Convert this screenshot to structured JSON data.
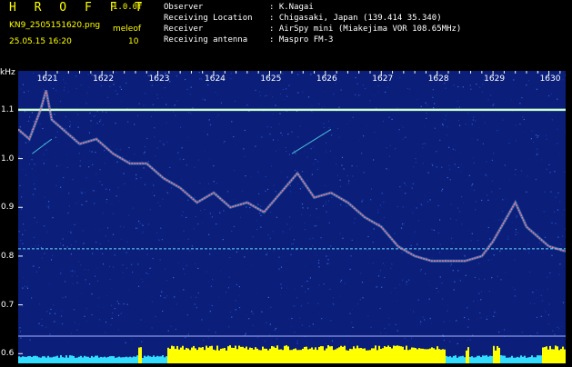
{
  "header": {
    "title": "H R O F F T",
    "version": "1.0.0f",
    "filename": "KN9_2505151620.png",
    "mode_label": "meleof",
    "datetime": "25.05.15 16:20",
    "mode_value": "10",
    "info": [
      {
        "label": "Observer",
        "value": ": K.Nagai"
      },
      {
        "label": "Receiving Location",
        "value": ": Chigasaki, Japan (139.414 35.340)"
      },
      {
        "label": "Receiver",
        "value": ": AirSpy mini (Miakejima VOR 108.65MHz)"
      },
      {
        "label": "Receiving antenna",
        "value": ": Maspro FM-3"
      }
    ]
  },
  "axis": {
    "unit": "kHz",
    "y_ticks": [
      "1.1",
      "1.0",
      "0.9",
      "0.8",
      "0.7",
      "0.6"
    ],
    "x_ticks": [
      "1621",
      "1622",
      "1623",
      "1624",
      "1625",
      "1626",
      "1627",
      "1628",
      "1629",
      "1630"
    ]
  },
  "colors": {
    "background": "#000000",
    "text_yellow": "#ffff00",
    "text_white": "#ffffff",
    "spectrum_bg": "#0a1e7a",
    "signal_pink": "#ff6f9a",
    "signal_cyan": "#66ffff",
    "bar_yellow": "#ffff00",
    "bar_cyan": "#33ddff"
  },
  "chart_data": {
    "type": "heatmap",
    "x_range": [
      1620.5,
      1630.3
    ],
    "y_range": [
      0.58,
      1.18
    ],
    "carrier_lines_khz": [
      1.1,
      0.815
    ],
    "doppler_trace": {
      "x": [
        1620.5,
        1620.7,
        1620.9,
        1621.0,
        1621.1,
        1621.3,
        1621.6,
        1621.9,
        1622.2,
        1622.5,
        1622.8,
        1623.1,
        1623.4,
        1623.7,
        1624.0,
        1624.3,
        1624.6,
        1624.9,
        1625.2,
        1625.5,
        1625.8,
        1626.1,
        1626.4,
        1626.7,
        1627.0,
        1627.3,
        1627.6,
        1627.9,
        1628.2,
        1628.5,
        1628.8,
        1629.0,
        1629.2,
        1629.4,
        1629.6,
        1629.8,
        1630.0,
        1630.3
      ],
      "y": [
        1.06,
        1.04,
        1.1,
        1.14,
        1.08,
        1.06,
        1.03,
        1.04,
        1.01,
        0.99,
        0.99,
        0.96,
        0.94,
        0.91,
        0.93,
        0.9,
        0.91,
        0.89,
        0.93,
        0.97,
        0.92,
        0.93,
        0.91,
        0.88,
        0.86,
        0.82,
        0.8,
        0.79,
        0.79,
        0.79,
        0.8,
        0.83,
        0.87,
        0.91,
        0.86,
        0.84,
        0.82,
        0.81
      ]
    }
  }
}
